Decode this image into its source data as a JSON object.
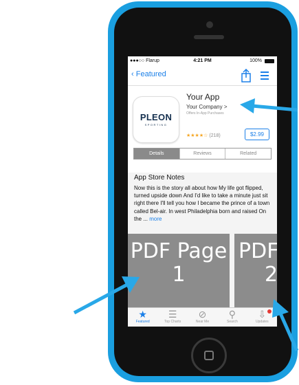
{
  "status_bar": {
    "carrier": "●●●○○ Flarup",
    "time": "4:21 PM",
    "battery": "100%"
  },
  "nav": {
    "back_label": "Featured"
  },
  "app": {
    "logo_text": "PLEON",
    "logo_subtext": "SPORTING",
    "title": "Your App",
    "company": "Your Company >",
    "subtitle": "Offers In-App Purchases",
    "stars": "★★★★☆",
    "rating_count": "(218)",
    "price": "$2.99"
  },
  "segments": [
    "Details",
    "Reviews",
    "Related"
  ],
  "notes": {
    "title": "App Store Notes",
    "body": "Now this is the story all about how My life got flipped, turned upside down And I'd like to take a minute just sit right there I'll tell you how I became the prince of a town called Bel-air. In west Philadelphia born and raised On the ...",
    "more": "more"
  },
  "pages": [
    {
      "label_line1": "PDF Page",
      "label_line2": "1"
    },
    {
      "label_line1": "PDF",
      "label_line2": "2"
    }
  ],
  "tabs": [
    {
      "label": "Featured",
      "icon": "star-icon"
    },
    {
      "label": "Top Charts",
      "icon": "list-icon"
    },
    {
      "label": "Near Me",
      "icon": "location-icon"
    },
    {
      "label": "Search",
      "icon": "search-icon"
    },
    {
      "label": "Updates",
      "icon": "download-icon"
    }
  ],
  "colors": {
    "phone": "#1a9fe0",
    "accent": "#1a7fe8",
    "arrow": "#29a8e8",
    "star": "#f5a623"
  }
}
